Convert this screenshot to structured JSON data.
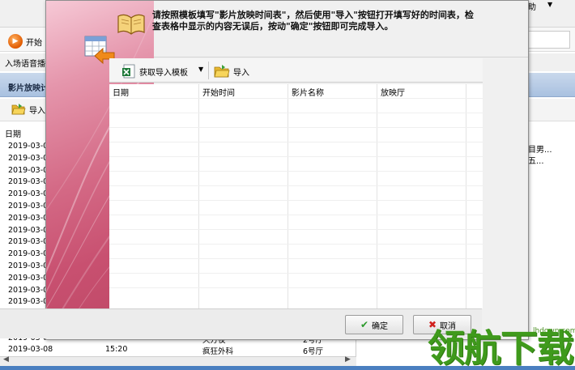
{
  "background_app": {
    "menu_help": "助",
    "menu_help_arrow": "▼",
    "start_button": "开始",
    "subtitle": "入场语音播",
    "panel_title": "影片放映计",
    "import_button": "导入",
    "list_header": "日期",
    "list_rows": [
      "2019-03-0",
      "2019-03-0",
      "2019-03-0",
      "2019-03-0",
      "2019-03-0",
      "2019-03-0",
      "2019-03-0",
      "2019-03-0",
      "2019-03-0",
      "2019-03-0",
      "2019-03-0",
      "2019-03-0",
      "2019-03-0",
      "2019-03-0",
      "2019-03-0"
    ],
    "right_texts": [
      "目男...",
      "五..."
    ],
    "bottom_row1": [
      "2019-03-0",
      "15:30",
      "天方夜",
      "2号厅"
    ],
    "bottom_row2": [
      "2019-03-08",
      "15:20",
      "疯狂外科",
      "6号厅"
    ],
    "scroll_left": "◀",
    "scroll_right": "▶"
  },
  "dialog": {
    "instruction": "请按照模板填写\"影片放映时间表\"，然后使用\"导入\"按钮打开填写好的时间表，检查表格中显示的内容无误后，按动\"确定\"按钮即可完成导入。",
    "toolbar": {
      "get_template": "获取导入模板",
      "dropdown_arrow": "▼",
      "import": "导入"
    },
    "grid_columns": [
      "日期",
      "开始时间",
      "影片名称",
      "放映厅"
    ],
    "ok_button": "确定",
    "cancel_button": "取消"
  },
  "watermark": {
    "url": "lhdown.com",
    "logo_text": "领航下载"
  },
  "colors": {
    "accent_blue": "#4a7fc0",
    "dialog_left_pink": "#d46a86",
    "watermark_green": "#3f9a1c"
  }
}
